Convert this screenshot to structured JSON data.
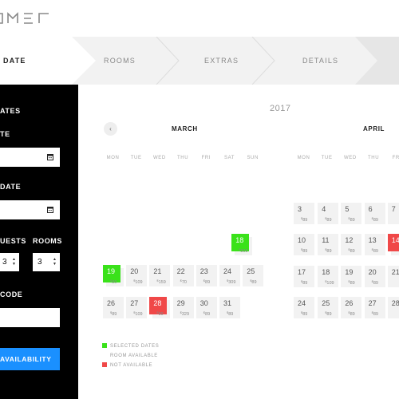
{
  "brand": {
    "colors": {
      "accent": "#1a90ff",
      "selected": "#3ae21a",
      "unavailable": "#f04848"
    }
  },
  "steps": [
    {
      "label": "DATE",
      "active": true
    },
    {
      "label": "ROOMS",
      "active": false
    },
    {
      "label": "EXTRAS",
      "active": false
    },
    {
      "label": "DETAILS",
      "active": false
    }
  ],
  "sidebar": {
    "heading": "ATES",
    "checkin_label": "TE",
    "checkout_label": "DATE",
    "guests_label": "UESTS",
    "rooms_label": "ROOMS",
    "guests_value": "3",
    "rooms_value": "3",
    "promo_label": "CODE",
    "check_button": "AVAILABILITY"
  },
  "calendar": {
    "year": "2017",
    "prev_icon": "chevron-left-icon",
    "weekdays": [
      "MON",
      "TUE",
      "WED",
      "THU",
      "FRI",
      "SAT",
      "SUN"
    ],
    "march": {
      "title": "MARCH",
      "days": [
        {
          "day": "18",
          "price": "309",
          "status": "selected"
        },
        {
          "day": "19",
          "price": "89",
          "status": "selected"
        },
        {
          "day": "20",
          "price": "109",
          "status": "available"
        },
        {
          "day": "21",
          "price": "159",
          "status": "available"
        },
        {
          "day": "22",
          "price": "70",
          "status": "available"
        },
        {
          "day": "23",
          "price": "89",
          "status": "available"
        },
        {
          "day": "24",
          "price": "309",
          "status": "available"
        },
        {
          "day": "25",
          "price": "89",
          "status": "available"
        },
        {
          "day": "26",
          "price": "89",
          "status": "available"
        },
        {
          "day": "27",
          "price": "109",
          "status": "available"
        },
        {
          "day": "28",
          "price": "89",
          "status": "unavailable"
        },
        {
          "day": "29",
          "price": "329",
          "status": "available"
        },
        {
          "day": "30",
          "price": "89",
          "status": "available"
        },
        {
          "day": "31",
          "price": "89",
          "status": "available"
        }
      ]
    },
    "april": {
      "title": "APRIL",
      "days": [
        {
          "day": "3",
          "price": "89",
          "status": "available"
        },
        {
          "day": "4",
          "price": "89",
          "status": "available"
        },
        {
          "day": "5",
          "price": "89",
          "status": "available"
        },
        {
          "day": "6",
          "price": "89",
          "status": "available"
        },
        {
          "day": "7",
          "price": "",
          "status": "available"
        },
        {
          "day": "10",
          "price": "89",
          "status": "available"
        },
        {
          "day": "11",
          "price": "89",
          "status": "available"
        },
        {
          "day": "12",
          "price": "89",
          "status": "available"
        },
        {
          "day": "13",
          "price": "89",
          "status": "available"
        },
        {
          "day": "14",
          "price": "",
          "status": "unavailable"
        },
        {
          "day": "17",
          "price": "89",
          "status": "available"
        },
        {
          "day": "18",
          "price": "109",
          "status": "available"
        },
        {
          "day": "19",
          "price": "89",
          "status": "available"
        },
        {
          "day": "20",
          "price": "89",
          "status": "available"
        },
        {
          "day": "21",
          "price": "",
          "status": "available"
        },
        {
          "day": "24",
          "price": "89",
          "status": "available"
        },
        {
          "day": "25",
          "price": "89",
          "status": "available"
        },
        {
          "day": "26",
          "price": "89",
          "status": "available"
        },
        {
          "day": "27",
          "price": "89",
          "status": "available"
        },
        {
          "day": "28",
          "price": "",
          "status": "available"
        }
      ]
    },
    "currency": "$"
  },
  "legend": [
    {
      "label": "SELECTED DATES",
      "color": "#3ae21a"
    },
    {
      "label": "ROOM AVAILABLE",
      "color": ""
    },
    {
      "label": "NOT AVAILABLE",
      "color": "#f04848"
    }
  ]
}
